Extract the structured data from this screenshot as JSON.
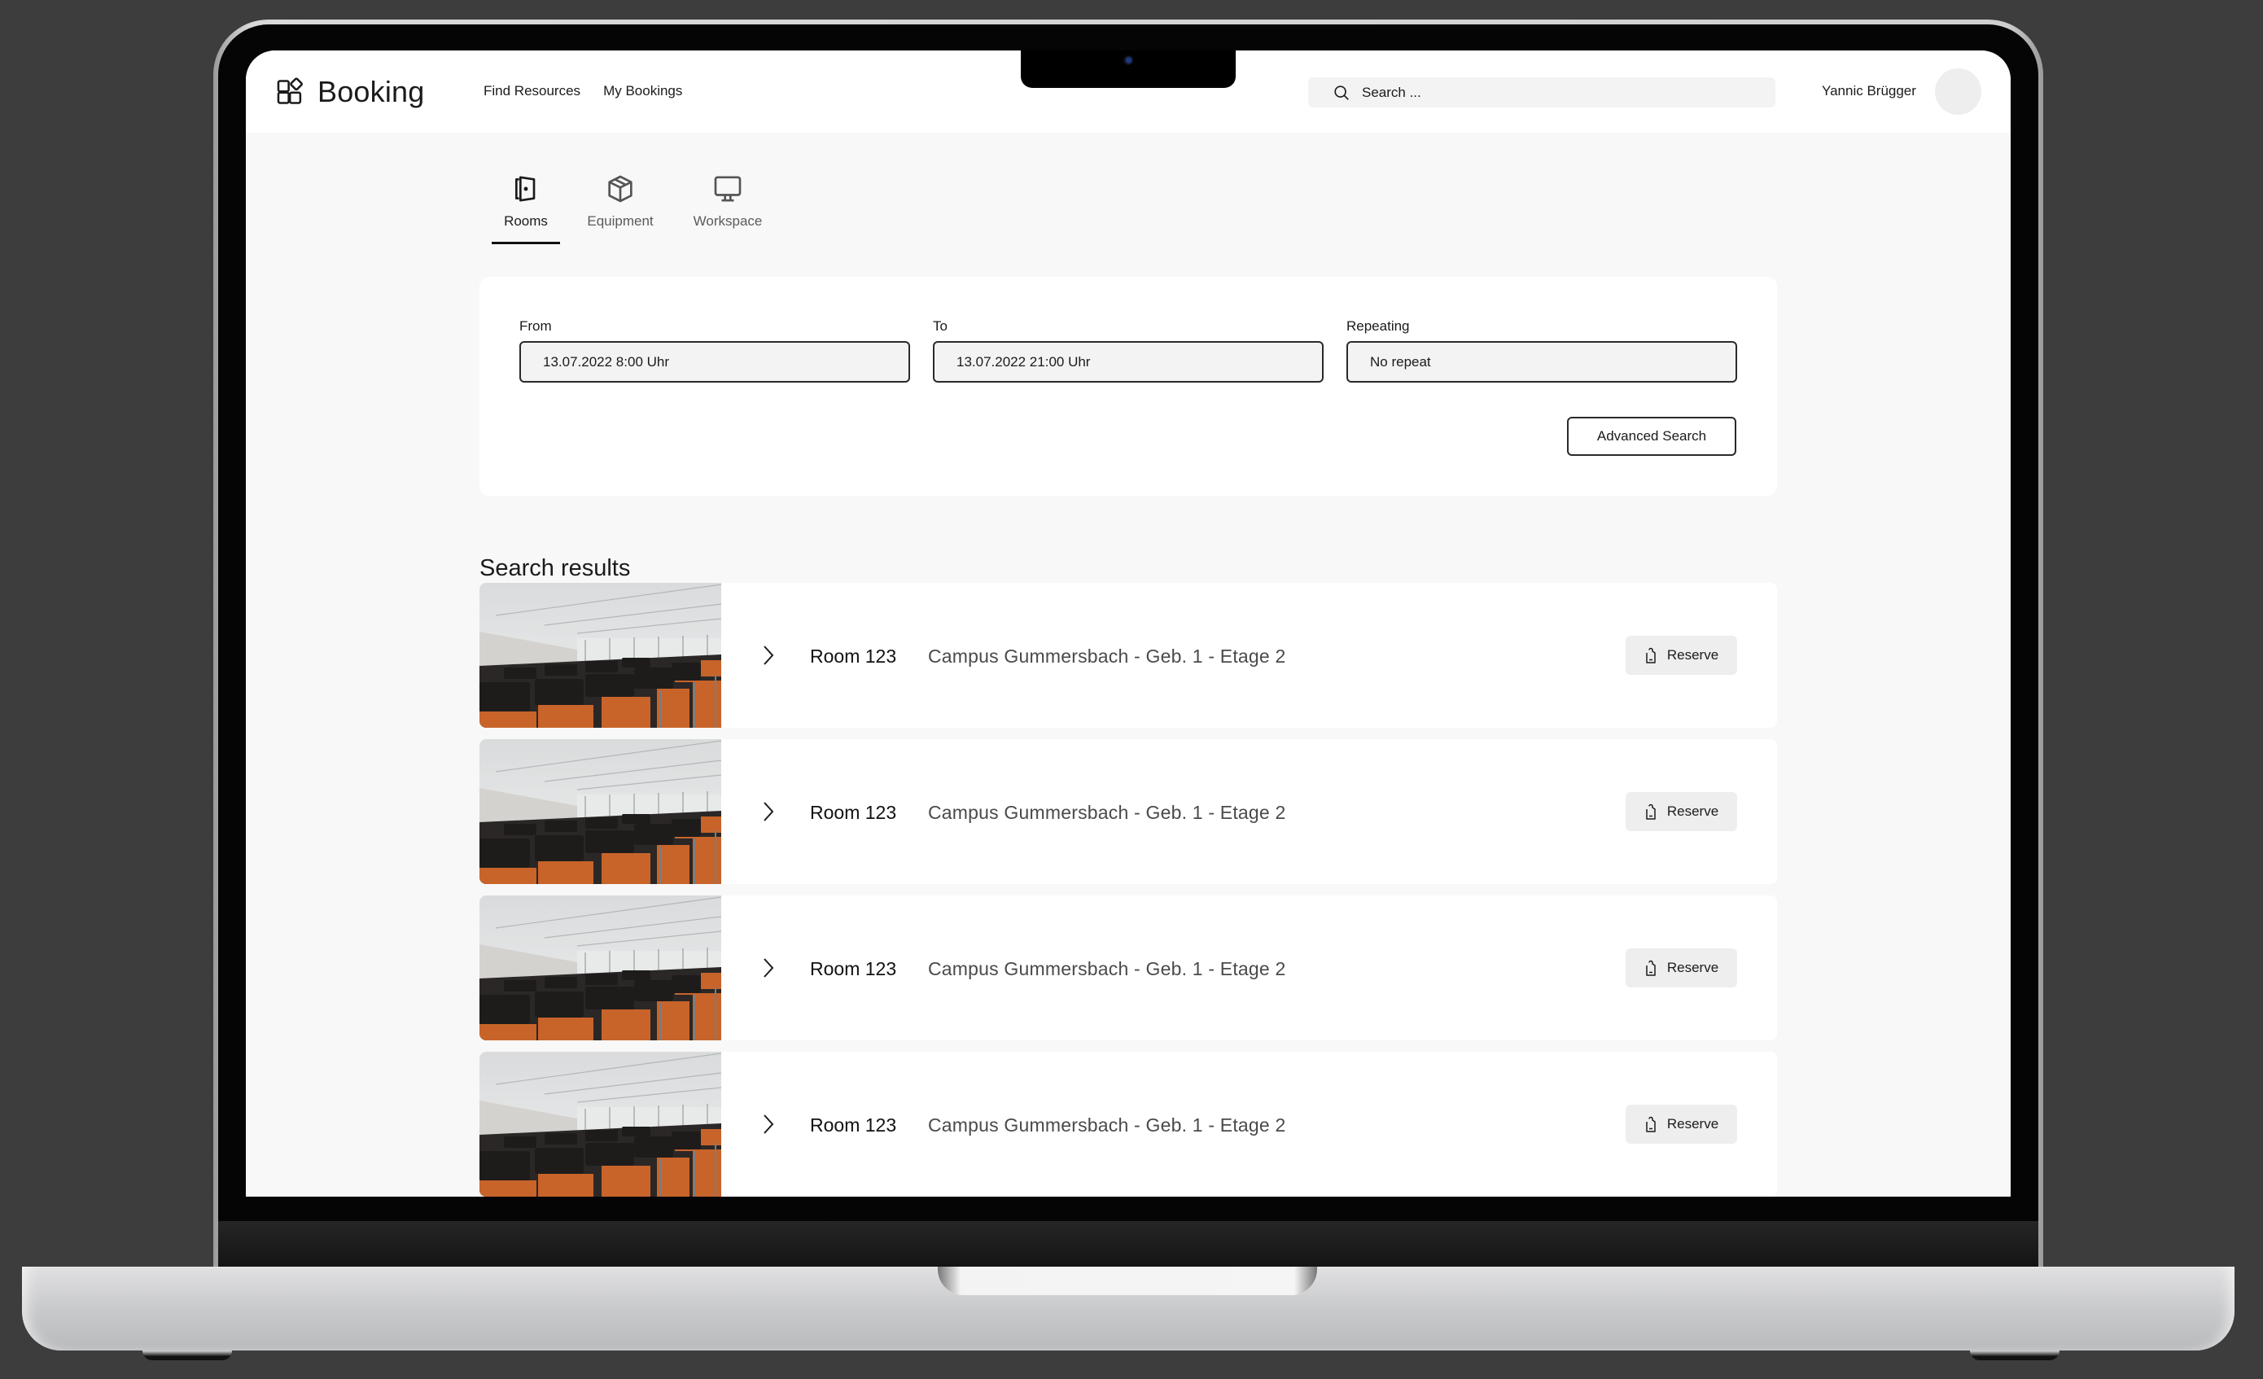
{
  "header": {
    "app_name": "Booking",
    "nav": [
      "Find Resources",
      "My Bookings"
    ],
    "search_placeholder": "Search ...",
    "user_name": "Yannic Brügger"
  },
  "tabs": [
    {
      "label": "Rooms",
      "icon": "door-icon",
      "active": true
    },
    {
      "label": "Equipment",
      "icon": "box-icon",
      "active": false
    },
    {
      "label": "Workspace",
      "icon": "monitor-icon",
      "active": false
    }
  ],
  "filter": {
    "from_label": "From",
    "from_value": "13.07.2022 8:00 Uhr",
    "to_label": "To",
    "to_value": "13.07.2022 21:00 Uhr",
    "repeat_label": "Repeating",
    "repeat_value": "No repeat",
    "advanced_label": "Advanced Search"
  },
  "results": {
    "title": "Search results",
    "items": [
      {
        "name": "Room 123",
        "location": "Campus Gummersbach - Geb. 1 - Etage 2",
        "action": "Reserve"
      },
      {
        "name": "Room 123",
        "location": "Campus Gummersbach - Geb. 1 - Etage 2",
        "action": "Reserve"
      },
      {
        "name": "Room 123",
        "location": "Campus Gummersbach - Geb. 1 - Etage 2",
        "action": "Reserve"
      },
      {
        "name": "Room 123",
        "location": "Campus Gummersbach - Geb. 1 - Etage 2",
        "action": "Reserve"
      }
    ]
  },
  "colors": {
    "background": "#3d3d3d",
    "screen_bg": "#f8f8f8",
    "text": "#1b1b1b",
    "seat_orange": "#c8642a"
  }
}
